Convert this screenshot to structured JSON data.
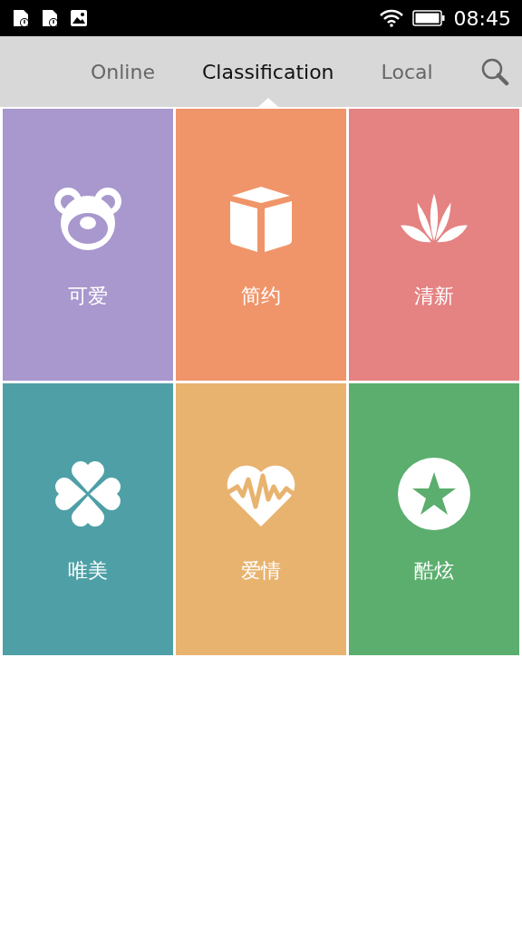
{
  "status_bar": {
    "time": "08:45"
  },
  "tabs": [
    {
      "label": "Online",
      "selected": false
    },
    {
      "label": "Classification",
      "selected": true
    },
    {
      "label": "Local",
      "selected": false
    }
  ],
  "categories": [
    {
      "label": "可爱",
      "kind": "bear",
      "color": "#a898cd"
    },
    {
      "label": "简约",
      "kind": "cube",
      "color": "#f0956a"
    },
    {
      "label": "清新",
      "kind": "lotus",
      "color": "#e58282"
    },
    {
      "label": "唯美",
      "kind": "clover",
      "color": "#4ea0a6"
    },
    {
      "label": "爱情",
      "kind": "heart",
      "color": "#e8b36f"
    },
    {
      "label": "酷炫",
      "kind": "star",
      "color": "#5bae6e"
    }
  ]
}
